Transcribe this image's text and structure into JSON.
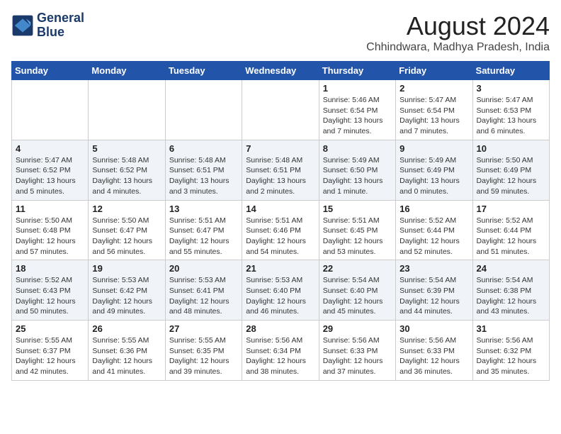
{
  "header": {
    "logo_line1": "General",
    "logo_line2": "Blue",
    "month_year": "August 2024",
    "location": "Chhindwara, Madhya Pradesh, India"
  },
  "weekdays": [
    "Sunday",
    "Monday",
    "Tuesday",
    "Wednesday",
    "Thursday",
    "Friday",
    "Saturday"
  ],
  "weeks": [
    [
      {
        "day": "",
        "info": ""
      },
      {
        "day": "",
        "info": ""
      },
      {
        "day": "",
        "info": ""
      },
      {
        "day": "",
        "info": ""
      },
      {
        "day": "1",
        "info": "Sunrise: 5:46 AM\nSunset: 6:54 PM\nDaylight: 13 hours\nand 7 minutes."
      },
      {
        "day": "2",
        "info": "Sunrise: 5:47 AM\nSunset: 6:54 PM\nDaylight: 13 hours\nand 7 minutes."
      },
      {
        "day": "3",
        "info": "Sunrise: 5:47 AM\nSunset: 6:53 PM\nDaylight: 13 hours\nand 6 minutes."
      }
    ],
    [
      {
        "day": "4",
        "info": "Sunrise: 5:47 AM\nSunset: 6:52 PM\nDaylight: 13 hours\nand 5 minutes."
      },
      {
        "day": "5",
        "info": "Sunrise: 5:48 AM\nSunset: 6:52 PM\nDaylight: 13 hours\nand 4 minutes."
      },
      {
        "day": "6",
        "info": "Sunrise: 5:48 AM\nSunset: 6:51 PM\nDaylight: 13 hours\nand 3 minutes."
      },
      {
        "day": "7",
        "info": "Sunrise: 5:48 AM\nSunset: 6:51 PM\nDaylight: 13 hours\nand 2 minutes."
      },
      {
        "day": "8",
        "info": "Sunrise: 5:49 AM\nSunset: 6:50 PM\nDaylight: 13 hours\nand 1 minute."
      },
      {
        "day": "9",
        "info": "Sunrise: 5:49 AM\nSunset: 6:49 PM\nDaylight: 13 hours\nand 0 minutes."
      },
      {
        "day": "10",
        "info": "Sunrise: 5:50 AM\nSunset: 6:49 PM\nDaylight: 12 hours\nand 59 minutes."
      }
    ],
    [
      {
        "day": "11",
        "info": "Sunrise: 5:50 AM\nSunset: 6:48 PM\nDaylight: 12 hours\nand 57 minutes."
      },
      {
        "day": "12",
        "info": "Sunrise: 5:50 AM\nSunset: 6:47 PM\nDaylight: 12 hours\nand 56 minutes."
      },
      {
        "day": "13",
        "info": "Sunrise: 5:51 AM\nSunset: 6:47 PM\nDaylight: 12 hours\nand 55 minutes."
      },
      {
        "day": "14",
        "info": "Sunrise: 5:51 AM\nSunset: 6:46 PM\nDaylight: 12 hours\nand 54 minutes."
      },
      {
        "day": "15",
        "info": "Sunrise: 5:51 AM\nSunset: 6:45 PM\nDaylight: 12 hours\nand 53 minutes."
      },
      {
        "day": "16",
        "info": "Sunrise: 5:52 AM\nSunset: 6:44 PM\nDaylight: 12 hours\nand 52 minutes."
      },
      {
        "day": "17",
        "info": "Sunrise: 5:52 AM\nSunset: 6:44 PM\nDaylight: 12 hours\nand 51 minutes."
      }
    ],
    [
      {
        "day": "18",
        "info": "Sunrise: 5:52 AM\nSunset: 6:43 PM\nDaylight: 12 hours\nand 50 minutes."
      },
      {
        "day": "19",
        "info": "Sunrise: 5:53 AM\nSunset: 6:42 PM\nDaylight: 12 hours\nand 49 minutes."
      },
      {
        "day": "20",
        "info": "Sunrise: 5:53 AM\nSunset: 6:41 PM\nDaylight: 12 hours\nand 48 minutes."
      },
      {
        "day": "21",
        "info": "Sunrise: 5:53 AM\nSunset: 6:40 PM\nDaylight: 12 hours\nand 46 minutes."
      },
      {
        "day": "22",
        "info": "Sunrise: 5:54 AM\nSunset: 6:40 PM\nDaylight: 12 hours\nand 45 minutes."
      },
      {
        "day": "23",
        "info": "Sunrise: 5:54 AM\nSunset: 6:39 PM\nDaylight: 12 hours\nand 44 minutes."
      },
      {
        "day": "24",
        "info": "Sunrise: 5:54 AM\nSunset: 6:38 PM\nDaylight: 12 hours\nand 43 minutes."
      }
    ],
    [
      {
        "day": "25",
        "info": "Sunrise: 5:55 AM\nSunset: 6:37 PM\nDaylight: 12 hours\nand 42 minutes."
      },
      {
        "day": "26",
        "info": "Sunrise: 5:55 AM\nSunset: 6:36 PM\nDaylight: 12 hours\nand 41 minutes."
      },
      {
        "day": "27",
        "info": "Sunrise: 5:55 AM\nSunset: 6:35 PM\nDaylight: 12 hours\nand 39 minutes."
      },
      {
        "day": "28",
        "info": "Sunrise: 5:56 AM\nSunset: 6:34 PM\nDaylight: 12 hours\nand 38 minutes."
      },
      {
        "day": "29",
        "info": "Sunrise: 5:56 AM\nSunset: 6:33 PM\nDaylight: 12 hours\nand 37 minutes."
      },
      {
        "day": "30",
        "info": "Sunrise: 5:56 AM\nSunset: 6:33 PM\nDaylight: 12 hours\nand 36 minutes."
      },
      {
        "day": "31",
        "info": "Sunrise: 5:56 AM\nSunset: 6:32 PM\nDaylight: 12 hours\nand 35 minutes."
      }
    ]
  ]
}
